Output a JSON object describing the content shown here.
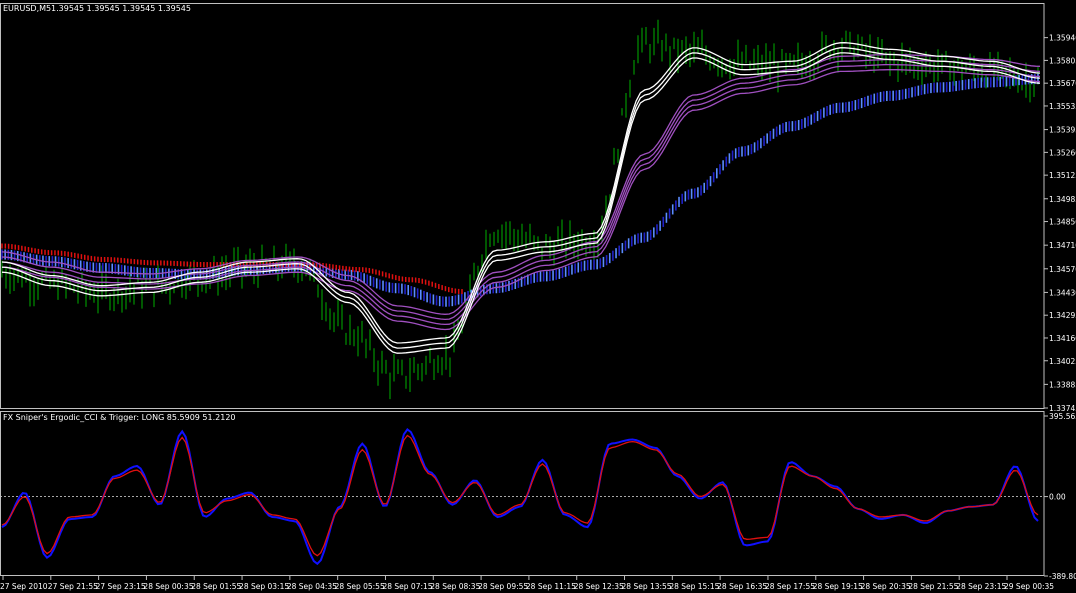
{
  "colors": {
    "background": "#000000",
    "frame": "#c0c0c0",
    "candle": "#00b000",
    "ribbon_white": "#ffffff",
    "ribbon_purple": "#a050c0",
    "ribbon_blue_dark": "#2020c8",
    "ribbon_blue_light": "#5a8cff",
    "ribbon_red": "#e01010",
    "cci": "#1010ff",
    "trigger": "#e01010",
    "zero_line": "#c0c0c0"
  },
  "main": {
    "symbol_title": "EURUSD,M5",
    "ohlc_text": "1.39545 1.39545 1.39545 1.39545"
  },
  "indicator": {
    "title": "FX Sniper's Ergodic_CCI & Trigger: LONG 85.5909 51.2120"
  },
  "chart_data": [
    {
      "type": "line",
      "title": "EURUSD,M5",
      "x": [
        "27 Sep 2010",
        "27 Sep 21:55",
        "27 Sep 23:15",
        "28 Sep 00:35",
        "28 Sep 01:55",
        "28 Sep 03:15",
        "28 Sep 04:35",
        "28 Sep 05:55",
        "28 Sep 07:15",
        "28 Sep 08:35",
        "28 Sep 09:55",
        "28 Sep 11:15",
        "28 Sep 12:35",
        "28 Sep 13:55",
        "28 Sep 15:15",
        "28 Sep 16:35",
        "28 Sep 17:55",
        "28 Sep 19:15",
        "28 Sep 20:35",
        "28 Sep 21:55",
        "28 Sep 23:15",
        "29 Sep 00:35"
      ],
      "y_ticks": [
        "1.35940",
        "1.35805",
        "1.35670",
        "1.35535",
        "1.35395",
        "1.35260",
        "1.35125",
        "1.34985",
        "1.34850",
        "1.34710",
        "1.34570",
        "1.34430",
        "1.34295",
        "1.34160",
        "1.34025",
        "1.33885",
        "1.33745"
      ],
      "ylim": [
        1.33745,
        1.3608
      ],
      "series": [
        {
          "role": "price",
          "values": [
            1.3455,
            1.3448,
            1.3443,
            1.3446,
            1.3452,
            1.3457,
            1.346,
            1.342,
            1.3393,
            1.3405,
            1.348,
            1.347,
            1.3475,
            1.359,
            1.3585,
            1.3578,
            1.3577,
            1.359,
            1.358,
            1.3577,
            1.3574,
            1.3568
          ]
        },
        {
          "role": "ribbon-white",
          "values": [
            1.3458,
            1.345,
            1.3444,
            1.3446,
            1.3452,
            1.3458,
            1.346,
            1.344,
            1.341,
            1.3413,
            1.3465,
            1.347,
            1.3475,
            1.356,
            1.3585,
            1.3575,
            1.3577,
            1.3588,
            1.3584,
            1.358,
            1.3577,
            1.357
          ]
        },
        {
          "role": "ribbon-purple",
          "values": [
            1.3462,
            1.3456,
            1.345,
            1.3449,
            1.3452,
            1.3457,
            1.3459,
            1.3448,
            1.343,
            1.3425,
            1.345,
            1.346,
            1.3468,
            1.352,
            1.3555,
            1.3565,
            1.357,
            1.3578,
            1.3579,
            1.3578,
            1.3576,
            1.3572
          ]
        },
        {
          "role": "ribbon-blue",
          "values": [
            1.3464,
            1.346,
            1.3456,
            1.3453,
            1.3452,
            1.3455,
            1.3457,
            1.3452,
            1.3444,
            1.3436,
            1.3444,
            1.3451,
            1.3458,
            1.3474,
            1.35,
            1.3525,
            1.354,
            1.3551,
            1.3558,
            1.3563,
            1.3566,
            1.3568
          ]
        },
        {
          "role": "ribbon-red",
          "values": [
            1.347,
            1.3466,
            1.3462,
            1.346,
            1.3459,
            1.3459,
            1.3459,
            1.3456,
            1.345,
            1.3443
          ]
        }
      ]
    },
    {
      "type": "line",
      "title": "FX Sniper's Ergodic_CCI & Trigger: LONG 85.5909 51.2120",
      "y_ticks": [
        "395.5654",
        "0.00",
        "-389.800"
      ],
      "ylim": [
        -389.8,
        395.5654
      ],
      "series": [
        {
          "role": "cci",
          "values": [
            -150,
            20,
            -300,
            -110,
            -100,
            100,
            150,
            -40,
            320,
            -100,
            -10,
            20,
            -100,
            -120,
            -330,
            -50,
            260,
            -50,
            330,
            120,
            -40,
            80,
            -100,
            -50,
            180,
            -90,
            -150,
            260,
            280,
            240,
            100,
            -10,
            70,
            -240,
            -220,
            170,
            100,
            50,
            -60,
            -110,
            -90,
            -130,
            -70,
            -50,
            -40,
            150,
            -120
          ]
        },
        {
          "role": "trigger",
          "values": [
            -140,
            0,
            -280,
            -100,
            -90,
            90,
            130,
            -30,
            290,
            -80,
            -20,
            10,
            -90,
            -110,
            -290,
            -60,
            230,
            -40,
            300,
            110,
            -30,
            70,
            -90,
            -40,
            160,
            -80,
            -130,
            240,
            270,
            230,
            110,
            0,
            60,
            -210,
            -200,
            150,
            100,
            40,
            -60,
            -100,
            -90,
            -120,
            -70,
            -50,
            -40,
            130,
            -90
          ]
        }
      ]
    }
  ]
}
